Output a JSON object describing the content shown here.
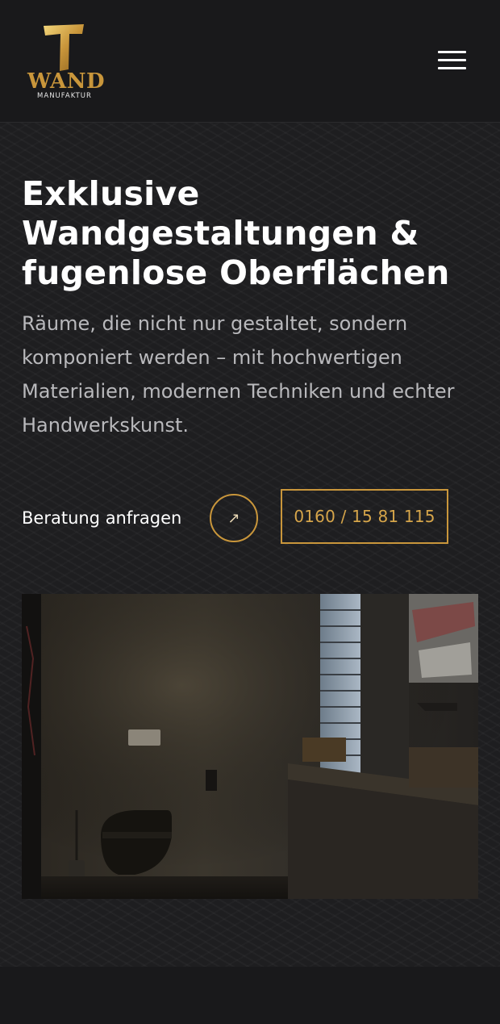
{
  "header": {
    "logo": {
      "wordmark": "WAND",
      "subline": "MANUFAKTUR",
      "brand_gold": "#c9963b"
    },
    "menu_icon": "hamburger-icon"
  },
  "hero": {
    "title": "Exklusive Wandgestaltungen & fugenlose Oberflächen",
    "text": "Räume, die nicht nur gestaltet, sondern komponiert werden – mit hochwertigen Materialien, modernen Techniken und echter Handwerkskunst.",
    "cta_label": "Beratung anfragen",
    "cta_icon": "arrow-up-right-icon",
    "phone": "0160 / 15 81 115"
  },
  "colors": {
    "background": "#1a1a1c",
    "accent": "#c9963b",
    "text_muted": "#b9b9bc"
  }
}
